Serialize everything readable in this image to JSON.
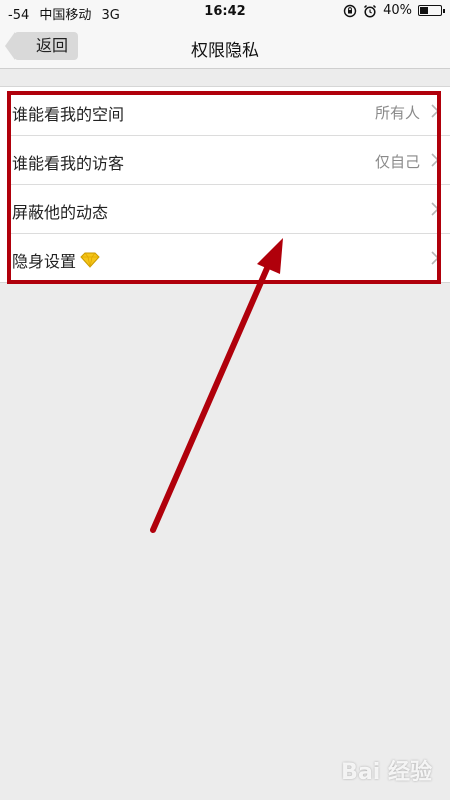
{
  "status_bar": {
    "signal": "-54",
    "carrier": "中国移动",
    "network": "3G",
    "time": "16:42",
    "battery_percent": "40%",
    "battery_level": 0.4
  },
  "nav": {
    "back_label": "返回",
    "title": "权限隐私"
  },
  "settings": {
    "rows": [
      {
        "label": "谁能看我的空间",
        "value": "所有人"
      },
      {
        "label": "谁能看我的访客",
        "value": "仅自己"
      },
      {
        "label": "屏蔽他的动态",
        "value": ""
      },
      {
        "label": "隐身设置",
        "value": ""
      }
    ]
  },
  "colors": {
    "annotation": "#b0000b",
    "diamond": "#f5c518"
  },
  "watermark": {
    "text": "Bai 经验"
  }
}
